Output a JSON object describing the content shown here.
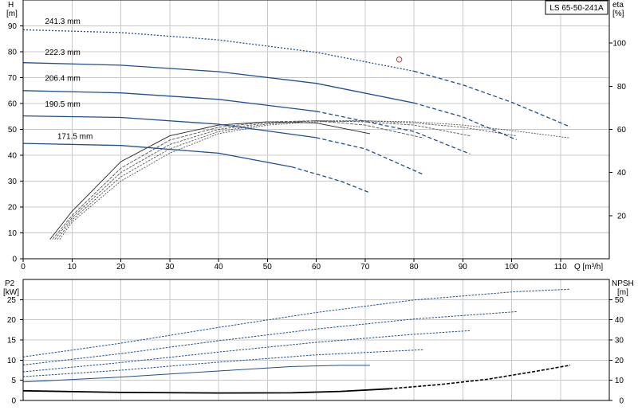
{
  "chart_data": [
    {
      "type": "line",
      "title": "LS 65-50-241A",
      "xlabel": "Q [m³/h]",
      "ylabel_line1": "H",
      "ylabel_line2": "[m]",
      "y2label_line1": "eta",
      "y2label_line2": "[%]",
      "xlim": [
        0,
        120
      ],
      "ylim": [
        0,
        100
      ],
      "y2lim": [
        0,
        120
      ],
      "x_ticks": [
        "0",
        "10",
        "20",
        "30",
        "40",
        "50",
        "60",
        "70",
        "80",
        "90",
        "100",
        "110"
      ],
      "y_ticks": [
        "0",
        "10",
        "20",
        "30",
        "40",
        "50",
        "60",
        "70",
        "80",
        "90"
      ],
      "y2_ticks": [
        "20",
        "40",
        "60",
        "80",
        "100"
      ],
      "grid": true,
      "color": "#1f4e96",
      "head_series": [
        {
          "name": "241.3 mm",
          "label_at": [
            2.5,
            90.8
          ],
          "x": [
            0,
            20,
            40,
            60,
            80,
            90,
            100,
            112
          ],
          "y": [
            88.5,
            87.4,
            84.6,
            79.8,
            72.5,
            67.2,
            60.5,
            51
          ]
        },
        {
          "name": "222.3 mm",
          "label_at": [
            2.5,
            78.8
          ],
          "x": [
            0,
            20,
            40,
            60,
            80,
            90,
            101
          ],
          "y": [
            75.8,
            74.8,
            72.3,
            67.8,
            60.2,
            54.8,
            46
          ]
        },
        {
          "name": "206.4 mm",
          "label_at": [
            2.5,
            68.8
          ],
          "x": [
            0,
            20,
            40,
            60,
            80,
            91.5
          ],
          "y": [
            65,
            64.1,
            61.6,
            57,
            49.2,
            40.5
          ]
        },
        {
          "name": "190.5 mm",
          "label_at": [
            2.5,
            58.8
          ],
          "x": [
            0,
            20,
            40,
            60,
            70,
            82
          ],
          "y": [
            55.2,
            54.6,
            52,
            46.8,
            42.5,
            32.5
          ]
        },
        {
          "name": "171.5 mm",
          "label_at": [
            7,
            46.3
          ],
          "x": [
            0,
            20,
            40,
            55,
            65,
            71
          ],
          "y": [
            44.6,
            43.8,
            40.8,
            35.5,
            30,
            25.5
          ]
        }
      ],
      "efficiency_series": [
        {
          "diameter": "171.5 mm",
          "x": [
            5.5,
            10,
            20,
            30,
            40,
            50,
            60,
            71
          ],
          "y": [
            9,
            22,
            45,
            57,
            62,
            63.5,
            63,
            58
          ]
        },
        {
          "diameter": "190.5 mm",
          "x": [
            6,
            10,
            20,
            30,
            40,
            50,
            60,
            70,
            82
          ],
          "y": [
            9,
            20,
            42,
            55,
            61,
            63.5,
            64,
            62,
            56
          ]
        },
        {
          "diameter": "206.4 mm",
          "x": [
            6.5,
            10,
            20,
            30,
            40,
            50,
            60,
            70,
            80,
            91.5
          ],
          "y": [
            9,
            19,
            40,
            53,
            60,
            63,
            64,
            63.5,
            62,
            57
          ]
        },
        {
          "diameter": "222.3 mm",
          "x": [
            7,
            10,
            20,
            30,
            40,
            50,
            60,
            70,
            80,
            90,
            101
          ],
          "y": [
            9,
            18,
            38,
            51,
            59,
            62.5,
            64,
            64,
            63,
            61,
            57
          ]
        },
        {
          "diameter": "241.3 mm",
          "x": [
            7.5,
            10,
            20,
            30,
            40,
            50,
            60,
            70,
            80,
            90,
            100,
            112
          ],
          "y": [
            9,
            17,
            36,
            49,
            58,
            62,
            63.5,
            64,
            63.5,
            62,
            59.5,
            56
          ]
        }
      ],
      "duty_point": {
        "x": 77,
        "y": 77,
        "color": "#e03020"
      }
    },
    {
      "type": "line",
      "xlim": [
        0,
        120
      ],
      "ylabel_line1": "P2",
      "ylabel_line2": "[kW]",
      "y2label_line1": "NPSH",
      "y2label_line2": "[m]",
      "ylim": [
        0,
        30
      ],
      "y2lim": [
        0,
        60
      ],
      "y_ticks": [
        "0",
        "5",
        "10",
        "15",
        "20",
        "25"
      ],
      "y2_ticks": [
        "0",
        "10",
        "20",
        "30",
        "40",
        "50"
      ],
      "grid": true,
      "power_series": [
        {
          "diameter": "241.3 mm",
          "x": [
            0,
            20,
            40,
            60,
            80,
            100,
            112
          ],
          "y": [
            10.8,
            14.2,
            18.1,
            21.8,
            24.9,
            26.9,
            27.6
          ]
        },
        {
          "diameter": "222.3 mm",
          "x": [
            0,
            20,
            40,
            60,
            80,
            101
          ],
          "y": [
            8.8,
            11.6,
            14.8,
            17.7,
            20.2,
            22.0
          ]
        },
        {
          "diameter": "206.4 mm",
          "x": [
            0,
            20,
            40,
            60,
            80,
            91.5
          ],
          "y": [
            7.1,
            9.4,
            12.0,
            14.4,
            16.4,
            17.3
          ]
        },
        {
          "diameter": "190.5 mm",
          "x": [
            0,
            20,
            40,
            60,
            82
          ],
          "y": [
            5.9,
            7.5,
            9.5,
            11.3,
            12.6
          ]
        },
        {
          "diameter": "171.5 mm",
          "x": [
            0,
            20,
            40,
            55,
            65,
            71
          ],
          "y": [
            4.6,
            5.8,
            7.3,
            8.4,
            8.7,
            8.7
          ]
        }
      ],
      "npsh_series": {
        "x": [
          0,
          20,
          40,
          55,
          65,
          75,
          85,
          95,
          105,
          112
        ],
        "y": [
          4.8,
          4.0,
          3.7,
          3.8,
          4.5,
          5.8,
          7.8,
          10.5,
          14.5,
          17.5
        ]
      }
    }
  ]
}
